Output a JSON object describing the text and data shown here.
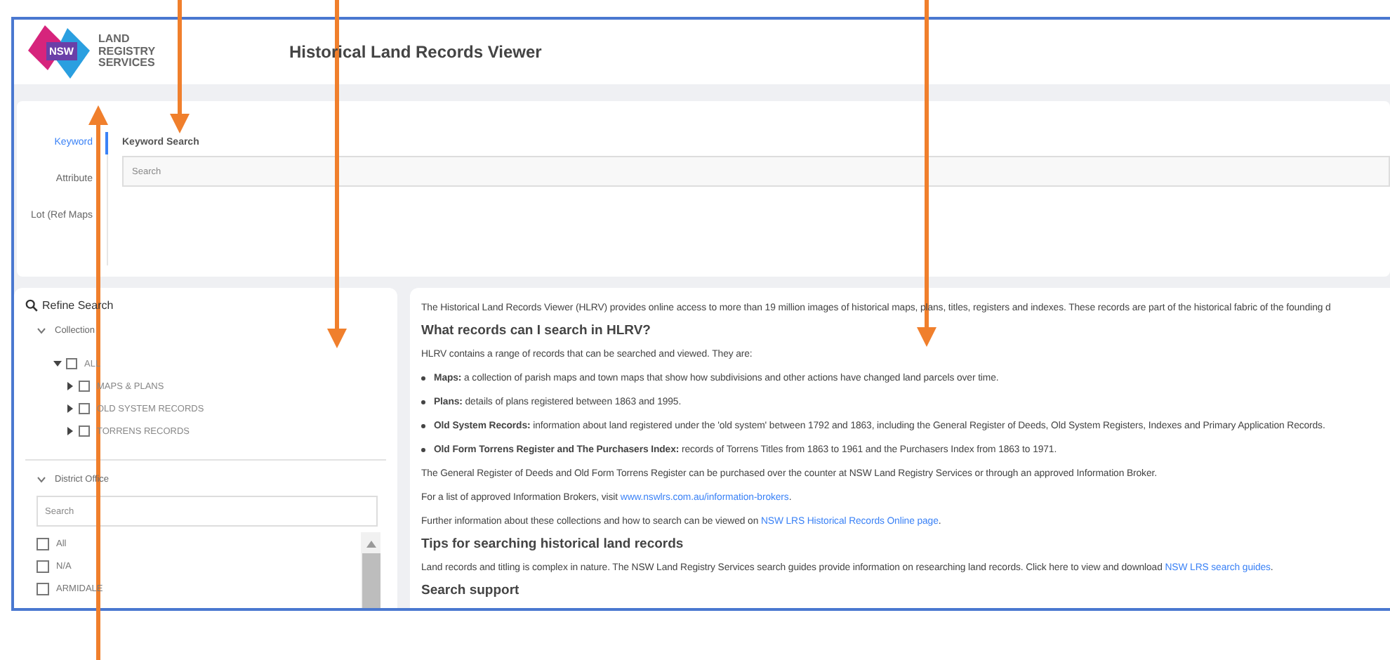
{
  "header": {
    "brand_badge": "NSW",
    "brand_name": "LAND REGISTRY SERVICES",
    "title": "Historical Land Records Viewer"
  },
  "search_tabs": [
    {
      "label": "Keyword",
      "selected": true
    },
    {
      "label": "Attribute",
      "selected": false
    },
    {
      "label": "Lot (Ref Maps",
      "selected": false
    }
  ],
  "keyword_search": {
    "heading": "Keyword Search",
    "placeholder": "Search"
  },
  "refine": {
    "title": "Refine Search",
    "collection": {
      "label": "Collection",
      "expanded": true,
      "tree": [
        {
          "label": "ALL",
          "checked": false,
          "expanded": true,
          "children": [
            {
              "label": "MAPS & PLANS",
              "checked": false,
              "expanded": false
            },
            {
              "label": "OLD SYSTEM RECORDS",
              "checked": false,
              "expanded": false
            },
            {
              "label": "TORRENS RECORDS",
              "checked": false,
              "expanded": false
            }
          ]
        }
      ]
    },
    "district": {
      "label": "District Office",
      "expanded": true,
      "placeholder": "Search",
      "items": [
        {
          "label": "All",
          "checked": false
        },
        {
          "label": "N/A",
          "checked": false
        },
        {
          "label": "ARMIDALE",
          "checked": false
        }
      ]
    }
  },
  "content": [
    {
      "kind": "paragraph",
      "parts": [
        {
          "text": "The Historical Land Records Viewer (HLRV) provides online access to more than 19 million images of historical maps, plans, titles, registers and indexes. These records are part of the historical fabric of the founding d",
          "link": false
        }
      ]
    },
    {
      "kind": "heading",
      "text": "What records can I search in HLRV?"
    },
    {
      "kind": "paragraph",
      "parts": [
        {
          "text": "HLRV contains a range of records that can be searched and viewed. They are:",
          "link": false
        }
      ]
    },
    {
      "kind": "bullet",
      "text": "**Maps:** a collection of parish maps and town maps that show how subdivisions and other actions have changed land parcels over time."
    },
    {
      "kind": "bullet",
      "text": "**Plans:** details of plans registered between 1863 and 1995."
    },
    {
      "kind": "bullet",
      "text": "**Old System Records:** information about land registered under the 'old system' between 1792 and 1863, including the General Register of Deeds, Old System Registers, Indexes and Primary Application Records."
    },
    {
      "kind": "bullet",
      "text": "**Old Form Torrens Register and The Purchasers Index:** records of Torrens Titles from 1863 to 1961 and the Purchasers Index from 1863 to 1971."
    },
    {
      "kind": "paragraph",
      "parts": [
        {
          "text": "The General Register of Deeds and Old Form Torrens Register can be purchased over the counter at NSW Land Registry Services or through an approved Information Broker.",
          "link": false
        }
      ]
    },
    {
      "kind": "paragraph",
      "parts": [
        {
          "text": "For a list of approved Information Brokers, visit ",
          "link": false
        },
        {
          "text": "www.nswlrs.com.au/information-brokers",
          "link": true
        },
        {
          "text": ".",
          "link": false
        }
      ]
    },
    {
      "kind": "paragraph",
      "parts": [
        {
          "text": "Further information about these collections and how to search can be viewed on ",
          "link": false
        },
        {
          "text": "NSW LRS Historical Records Online page",
          "link": true
        },
        {
          "text": ".",
          "link": false
        }
      ]
    },
    {
      "kind": "heading",
      "text": "Tips for searching historical land records"
    },
    {
      "kind": "paragraph",
      "parts": [
        {
          "text": "Land records and titling is complex in nature. The NSW Land Registry Services search guides provide information on researching land records. Click here to view and download ",
          "link": false
        },
        {
          "text": "NSW LRS search guides",
          "link": true
        },
        {
          "text": ".",
          "link": false
        }
      ]
    },
    {
      "kind": "heading",
      "text": "Search support"
    }
  ]
}
